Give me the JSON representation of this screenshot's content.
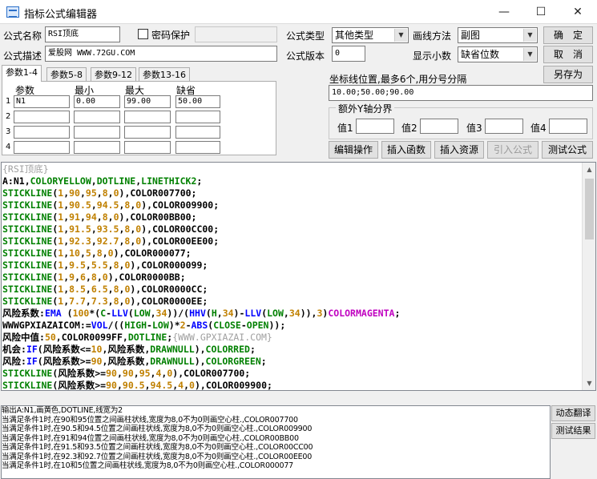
{
  "window": {
    "title": "指标公式编辑器",
    "min_glyph": "—",
    "max_glyph": "☐",
    "close_glyph": "✕"
  },
  "form": {
    "name_label": "公式名称",
    "name_value": "RSI顶底",
    "password_label": "密码保护",
    "desc_label": "公式描述",
    "desc_value": "爱股网 WWW.72GU.COM",
    "type_label": "公式类型",
    "type_value": "其他类型",
    "draw_label": "画线方法",
    "draw_value": "副图",
    "version_label": "公式版本",
    "version_value": "0",
    "decimals_label": "显示小数",
    "decimals_value": "缺省位数"
  },
  "buttons": {
    "ok": "确　定",
    "cancel": "取　消",
    "save_as": "另存为",
    "edit_ops": "编辑操作",
    "insert_func": "插入函数",
    "insert_res": "插入资源",
    "import_formula": "引入公式",
    "test_formula": "测试公式",
    "dynamic_translate": "动态翻译",
    "test_result": "测试结果"
  },
  "tabs": [
    "参数1-4",
    "参数5-8",
    "参数9-12",
    "参数13-16"
  ],
  "params": {
    "headers": [
      "参数",
      "最小",
      "最大",
      "缺省"
    ],
    "rows": [
      {
        "num": "1",
        "name": "N1",
        "min": "0.00",
        "max": "99.00",
        "default": "50.00"
      },
      {
        "num": "2",
        "name": "",
        "min": "",
        "max": "",
        "default": ""
      },
      {
        "num": "3",
        "name": "",
        "min": "",
        "max": "",
        "default": ""
      },
      {
        "num": "4",
        "name": "",
        "min": "",
        "max": "",
        "default": ""
      }
    ]
  },
  "axis": {
    "label": "坐标线位置,最多6个,用分号分隔",
    "value": "10.00;50.00;90.00",
    "group_label": "额外Y轴分界",
    "v1": "值1",
    "v2": "值2",
    "v3": "值3",
    "v4": "值4"
  },
  "colors": {
    "green": "#008000",
    "orange": "#c08000",
    "black": "#000000",
    "blue": "#0000ff",
    "magenta": "#c000c0",
    "gray": "#a0a0a0",
    "maroon": "#800000"
  },
  "code_lines": [
    [
      [
        "{RSI顶底}",
        "gray"
      ]
    ],
    [
      [
        "A:N1,",
        "black"
      ],
      [
        "COLORYELLOW",
        "green"
      ],
      [
        ",",
        "black"
      ],
      [
        "DOTLINE",
        "green"
      ],
      [
        ",",
        "black"
      ],
      [
        "LINETHICK2",
        "green"
      ],
      [
        ";",
        "black"
      ]
    ],
    [
      [
        "STICKLINE",
        "green"
      ],
      [
        "(",
        "black"
      ],
      [
        "1",
        "orange"
      ],
      [
        ",",
        "black"
      ],
      [
        "90",
        "orange"
      ],
      [
        ",",
        "black"
      ],
      [
        "95",
        "orange"
      ],
      [
        ",",
        "black"
      ],
      [
        "8",
        "orange"
      ],
      [
        ",",
        "black"
      ],
      [
        "0",
        "orange"
      ],
      [
        "),COLOR007700;",
        "black"
      ]
    ],
    [
      [
        "STICKLINE",
        "green"
      ],
      [
        "(",
        "black"
      ],
      [
        "1",
        "orange"
      ],
      [
        ",",
        "black"
      ],
      [
        "90.5",
        "orange"
      ],
      [
        ",",
        "black"
      ],
      [
        "94.5",
        "orange"
      ],
      [
        ",",
        "black"
      ],
      [
        "8",
        "orange"
      ],
      [
        ",",
        "black"
      ],
      [
        "0",
        "orange"
      ],
      [
        "),COLOR009900;",
        "black"
      ]
    ],
    [
      [
        "STICKLINE",
        "green"
      ],
      [
        "(",
        "black"
      ],
      [
        "1",
        "orange"
      ],
      [
        ",",
        "black"
      ],
      [
        "91",
        "orange"
      ],
      [
        ",",
        "black"
      ],
      [
        "94",
        "orange"
      ],
      [
        ",",
        "black"
      ],
      [
        "8",
        "orange"
      ],
      [
        ",",
        "black"
      ],
      [
        "0",
        "orange"
      ],
      [
        "),COLOR00BB00;",
        "black"
      ]
    ],
    [
      [
        "STICKLINE",
        "green"
      ],
      [
        "(",
        "black"
      ],
      [
        "1",
        "orange"
      ],
      [
        ",",
        "black"
      ],
      [
        "91.5",
        "orange"
      ],
      [
        ",",
        "black"
      ],
      [
        "93.5",
        "orange"
      ],
      [
        ",",
        "black"
      ],
      [
        "8",
        "orange"
      ],
      [
        ",",
        "black"
      ],
      [
        "0",
        "orange"
      ],
      [
        "),COLOR00CC00;",
        "black"
      ]
    ],
    [
      [
        "STICKLINE",
        "green"
      ],
      [
        "(",
        "black"
      ],
      [
        "1",
        "orange"
      ],
      [
        ",",
        "black"
      ],
      [
        "92.3",
        "orange"
      ],
      [
        ",",
        "black"
      ],
      [
        "92.7",
        "orange"
      ],
      [
        ",",
        "black"
      ],
      [
        "8",
        "orange"
      ],
      [
        ",",
        "black"
      ],
      [
        "0",
        "orange"
      ],
      [
        "),COLOR00EE00;",
        "black"
      ]
    ],
    [
      [
        "STICKLINE",
        "green"
      ],
      [
        "(",
        "black"
      ],
      [
        "1",
        "orange"
      ],
      [
        ",",
        "black"
      ],
      [
        "10",
        "orange"
      ],
      [
        ",",
        "black"
      ],
      [
        "5",
        "orange"
      ],
      [
        ",",
        "black"
      ],
      [
        "8",
        "orange"
      ],
      [
        ",",
        "black"
      ],
      [
        "0",
        "orange"
      ],
      [
        "),COLOR000077;",
        "black"
      ]
    ],
    [
      [
        "STICKLINE",
        "green"
      ],
      [
        "(",
        "black"
      ],
      [
        "1",
        "orange"
      ],
      [
        ",",
        "black"
      ],
      [
        "9.5",
        "orange"
      ],
      [
        ",",
        "black"
      ],
      [
        "5.5",
        "orange"
      ],
      [
        ",",
        "black"
      ],
      [
        "8",
        "orange"
      ],
      [
        ",",
        "black"
      ],
      [
        "0",
        "orange"
      ],
      [
        "),COLOR000099;",
        "black"
      ]
    ],
    [
      [
        "STICKLINE",
        "green"
      ],
      [
        "(",
        "black"
      ],
      [
        "1",
        "orange"
      ],
      [
        ",",
        "black"
      ],
      [
        "9",
        "orange"
      ],
      [
        ",",
        "black"
      ],
      [
        "6",
        "orange"
      ],
      [
        ",",
        "black"
      ],
      [
        "8",
        "orange"
      ],
      [
        ",",
        "black"
      ],
      [
        "0",
        "orange"
      ],
      [
        "),COLOR0000BB;",
        "black"
      ]
    ],
    [
      [
        "STICKLINE",
        "green"
      ],
      [
        "(",
        "black"
      ],
      [
        "1",
        "orange"
      ],
      [
        ",",
        "black"
      ],
      [
        "8.5",
        "orange"
      ],
      [
        ",",
        "black"
      ],
      [
        "6.5",
        "orange"
      ],
      [
        ",",
        "black"
      ],
      [
        "8",
        "orange"
      ],
      [
        ",",
        "black"
      ],
      [
        "0",
        "orange"
      ],
      [
        "),COLOR0000CC;",
        "black"
      ]
    ],
    [
      [
        "STICKLINE",
        "green"
      ],
      [
        "(",
        "black"
      ],
      [
        "1",
        "orange"
      ],
      [
        ",",
        "black"
      ],
      [
        "7.7",
        "orange"
      ],
      [
        ",",
        "black"
      ],
      [
        "7.3",
        "orange"
      ],
      [
        ",",
        "black"
      ],
      [
        "8",
        "orange"
      ],
      [
        ",",
        "black"
      ],
      [
        "0",
        "orange"
      ],
      [
        "),COLOR0000EE;",
        "black"
      ]
    ],
    [
      [
        "风险系数:",
        "black"
      ],
      [
        "EMA",
        "blue"
      ],
      [
        " (",
        "black"
      ],
      [
        "100",
        "orange"
      ],
      [
        "*(",
        "black"
      ],
      [
        "C",
        "green"
      ],
      [
        "-",
        "black"
      ],
      [
        "LLV",
        "blue"
      ],
      [
        "(",
        "black"
      ],
      [
        "LOW",
        "green"
      ],
      [
        ",",
        "black"
      ],
      [
        "34",
        "orange"
      ],
      [
        "))/(",
        "black"
      ],
      [
        "HHV",
        "blue"
      ],
      [
        "(",
        "black"
      ],
      [
        "H",
        "green"
      ],
      [
        ",",
        "black"
      ],
      [
        "34",
        "orange"
      ],
      [
        ")-",
        "black"
      ],
      [
        "LLV",
        "blue"
      ],
      [
        "(",
        "black"
      ],
      [
        "LOW",
        "green"
      ],
      [
        ",",
        "black"
      ],
      [
        "34",
        "orange"
      ],
      [
        ")),",
        "black"
      ],
      [
        "3",
        "orange"
      ],
      [
        ")",
        "black"
      ],
      [
        "COLORMAGENTA",
        "magenta"
      ],
      [
        ";",
        "black"
      ]
    ],
    [
      [
        "WWWGPXIAZAICOM:=",
        "black"
      ],
      [
        "VOL",
        "blue"
      ],
      [
        "/((",
        "black"
      ],
      [
        "HIGH",
        "green"
      ],
      [
        "-",
        "black"
      ],
      [
        "LOW",
        "green"
      ],
      [
        ")*",
        "black"
      ],
      [
        "2",
        "orange"
      ],
      [
        "-",
        "black"
      ],
      [
        "ABS",
        "blue"
      ],
      [
        "(",
        "black"
      ],
      [
        "CLOSE",
        "green"
      ],
      [
        "-",
        "black"
      ],
      [
        "OPEN",
        "green"
      ],
      [
        "));",
        "black"
      ]
    ],
    [
      [
        "风险中值:",
        "black"
      ],
      [
        "50",
        "orange"
      ],
      [
        ",COLOR0099FF,",
        "black"
      ],
      [
        "DOTLINE",
        "green"
      ],
      [
        ";",
        "black"
      ],
      [
        "{WWW.GPXIAZAI.COM}",
        "gray"
      ]
    ],
    [
      [
        "机会:",
        "black"
      ],
      [
        "IF",
        "blue"
      ],
      [
        "(风险系数<=",
        "black"
      ],
      [
        "10",
        "orange"
      ],
      [
        ",风险系数,",
        "black"
      ],
      [
        "DRAWNULL",
        "green"
      ],
      [
        "),",
        "black"
      ],
      [
        "COLORRED",
        "green"
      ],
      [
        ";",
        "black"
      ]
    ],
    [
      [
        "风险:",
        "black"
      ],
      [
        "IF",
        "blue"
      ],
      [
        "(风险系数>=",
        "black"
      ],
      [
        "90",
        "orange"
      ],
      [
        ",风险系数,",
        "black"
      ],
      [
        "DRAWNULL",
        "green"
      ],
      [
        "),",
        "black"
      ],
      [
        "COLORGREEN",
        "green"
      ],
      [
        ";",
        "black"
      ]
    ],
    [
      [
        "STICKLINE",
        "green"
      ],
      [
        "(风险系数>=",
        "black"
      ],
      [
        "90",
        "orange"
      ],
      [
        ",",
        "black"
      ],
      [
        "90",
        "orange"
      ],
      [
        ",",
        "black"
      ],
      [
        "95",
        "orange"
      ],
      [
        ",",
        "black"
      ],
      [
        "4",
        "orange"
      ],
      [
        ",",
        "black"
      ],
      [
        "0",
        "orange"
      ],
      [
        "),COLOR007700;",
        "black"
      ]
    ],
    [
      [
        "STICKLINE",
        "green"
      ],
      [
        "(风险系数>=",
        "black"
      ],
      [
        "90",
        "orange"
      ],
      [
        ",",
        "black"
      ],
      [
        "90.5",
        "orange"
      ],
      [
        ",",
        "black"
      ],
      [
        "94.5",
        "orange"
      ],
      [
        ",",
        "black"
      ],
      [
        "4",
        "orange"
      ],
      [
        ",",
        "black"
      ],
      [
        "0",
        "orange"
      ],
      [
        "),COLOR009900;",
        "black"
      ]
    ]
  ],
  "output_lines": [
    "输出A:N1,画黄色,DOTLINE,线宽为2",
    "当满足条件1时,在90和95位置之间画柱状线,宽度为8,0不为0则画空心柱.,COLOR007700",
    "当满足条件1时,在90.5和94.5位置之间画柱状线,宽度为8,0不为0则画空心柱.,COLOR009900",
    "当满足条件1时,在91和94位置之间画柱状线,宽度为8,0不为0则画空心柱.,COLOR00BB00",
    "当满足条件1时,在91.5和93.5位置之间画柱状线,宽度为8,0不为0则画空心柱.,COLOR00CC00",
    "当满足条件1时,在92.3和92.7位置之间画柱状线,宽度为8,0不为0则画空心柱.,COLOR00EE00",
    "当满足条件1时,在10和5位置之间画柱状线,宽度为8,0不为0则画空心柱.,COLOR000077"
  ]
}
